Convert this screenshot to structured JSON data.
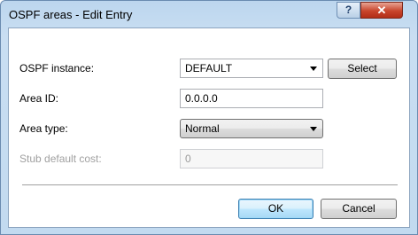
{
  "window": {
    "title": "OSPF areas - Edit Entry",
    "help_glyph": "?",
    "close_glyph": "✕"
  },
  "form": {
    "ospf_instance": {
      "label": "OSPF instance:",
      "value": "DEFAULT",
      "button": "Select"
    },
    "area_id": {
      "label": "Area ID:",
      "value": "0.0.0.0"
    },
    "area_type": {
      "label": "Area type:",
      "value": "Normal"
    },
    "stub_default_cost": {
      "label": "Stub default cost:",
      "value": "0"
    }
  },
  "buttons": {
    "ok": "OK",
    "cancel": "Cancel"
  }
}
